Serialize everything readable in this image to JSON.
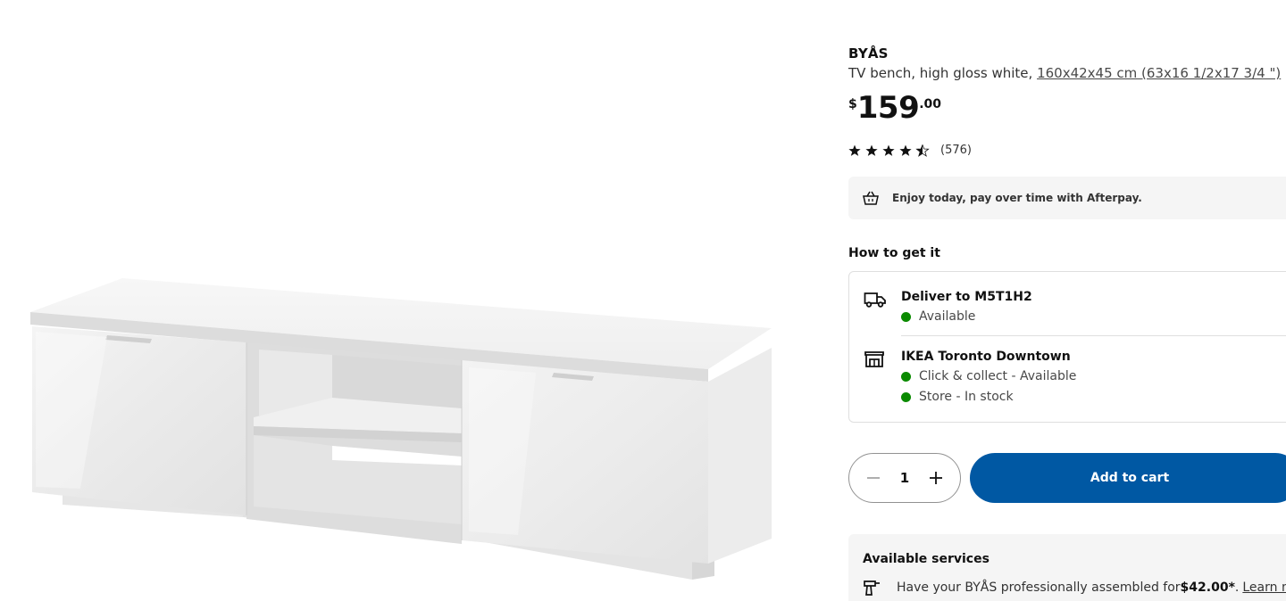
{
  "product": {
    "name": "BYÅS",
    "description": "TV bench, high gloss white, ",
    "dimensions": "160x42x45 cm (63x16 1/2x17 3/4 \")",
    "image_alt": "BYÅS TV bench, high gloss white"
  },
  "price": {
    "currency": "$",
    "integer": "159",
    "decimal": ".00"
  },
  "rating": {
    "stars": 4.5,
    "max_stars": 5,
    "count": "(576)"
  },
  "afterpay": {
    "text": "Enjoy today, pay over time with Afterpay.",
    "icon": "afterpay-basket-icon"
  },
  "fulfilment": {
    "title": "How to get it",
    "delivery": {
      "icon": "truck-icon",
      "title": "Deliver to M5T1H2",
      "status": "Available",
      "status_color": "#0a8a00"
    },
    "store": {
      "icon": "store-icon",
      "title": "IKEA Toronto Downtown",
      "statuses": [
        "Click & collect - Available",
        "Store - In stock"
      ],
      "status_color": "#0a8a00"
    }
  },
  "purchase": {
    "quantity": "1",
    "add_to_cart": "Add to cart",
    "button_color": "#0058a3"
  },
  "services": {
    "title": "Available services",
    "icon": "drill-icon",
    "text_before": "Have your BYÅS professionally assembled for ",
    "price": "$42.00*",
    "text_after": ".",
    "link": "Learn mo"
  }
}
